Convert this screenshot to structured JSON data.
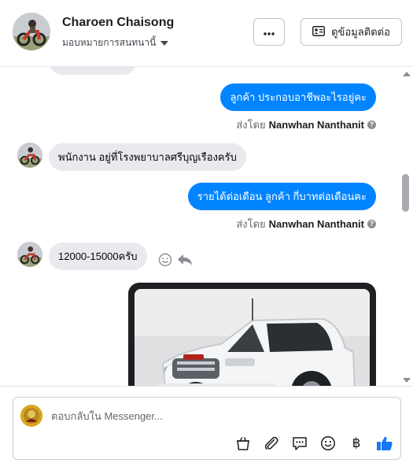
{
  "header": {
    "contact_name": "Charoen Chaisong",
    "assign_label": "มอบหมายการสนทนานี้",
    "more_icon": "more-dots-icon",
    "contact_button_label": "ดูข้อมูลติดต่อ"
  },
  "messages": [
    {
      "direction": "out",
      "text": "ลูกค้า  ประกอบอาชีพอะไรอยู่คะ",
      "sent_by_prefix": "ส่งโดย",
      "sent_by_name": "Nanwhan Nanthanit"
    },
    {
      "direction": "in",
      "text": "พนักงาน อยู่ที่โรงพยาบาลศรีบุญเรืองครับ"
    },
    {
      "direction": "out",
      "text": "รายได้ต่อเดือน ลูกค้า   กี่บาทต่อเดือนคะ",
      "sent_by_prefix": "ส่งโดย",
      "sent_by_name": "Nanwhan Nanthanit"
    },
    {
      "direction": "in",
      "text": "12000-15000ครับ"
    },
    {
      "direction": "in",
      "type": "photo",
      "description_icon": "pickup-truck-photo"
    }
  ],
  "composer": {
    "placeholder": "ตอบกลับใน Messenger...",
    "tools": [
      "shopping-bag-icon",
      "attachment-icon",
      "saved-reply-icon",
      "emoji-icon",
      "baht-icon",
      "like-icon"
    ]
  },
  "colors": {
    "outgoing_bubble": "#0084ff",
    "incoming_bubble": "#e9eaee",
    "like": "#1877f2"
  }
}
